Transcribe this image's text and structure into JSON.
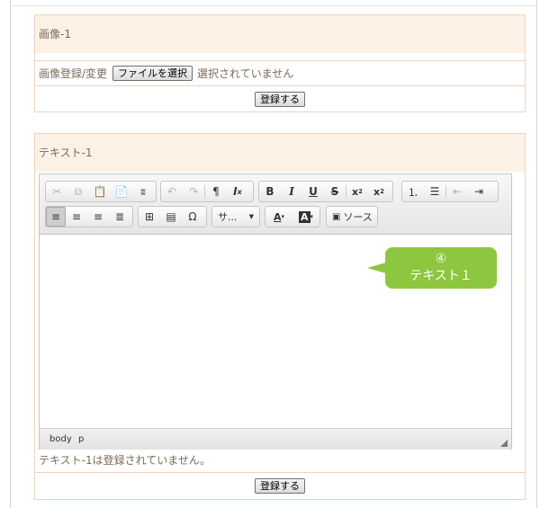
{
  "image_section": {
    "heading": "画像-1",
    "field_label": "画像登録/変更",
    "file_button_label": "ファイルを選択",
    "file_status": "選択されていません",
    "submit_label": "登録する"
  },
  "text_section": {
    "heading": "テキスト-1",
    "toolbar": {
      "format_dropdown": "サ...",
      "source_label": "ソース"
    },
    "content": "",
    "statusbar_path": [
      "body",
      "p"
    ],
    "status_message": "テキスト-1は登録されていません。",
    "submit_label": "登録する"
  },
  "callout": {
    "number": "④",
    "label": "テキスト１",
    "color": "#8dc63f"
  },
  "colors": {
    "panel_header_bg": "#fdf1e6",
    "panel_border": "#f0d2bc",
    "label_text": "#7a6a5a"
  }
}
